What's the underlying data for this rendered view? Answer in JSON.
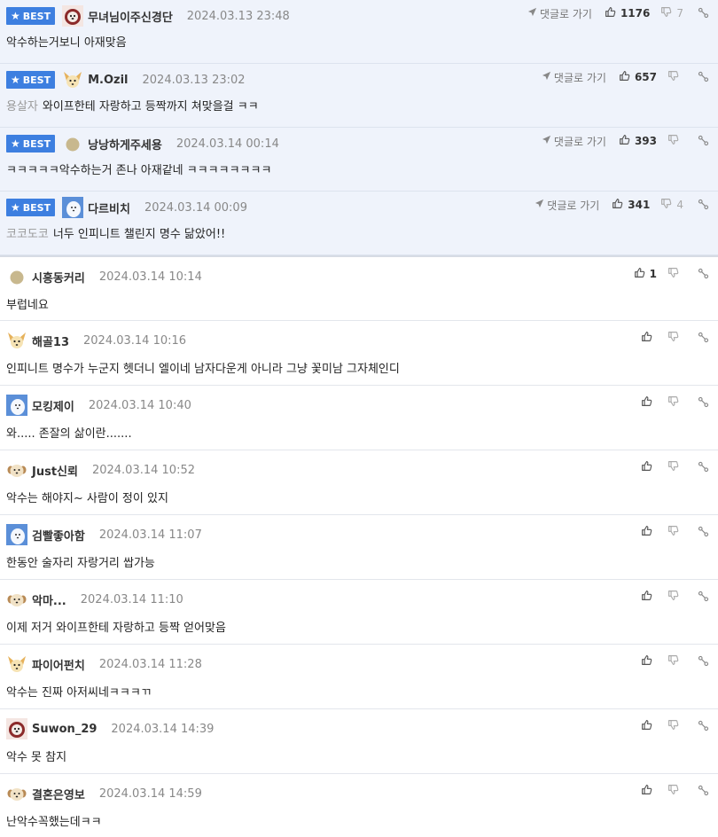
{
  "labels": {
    "best": "BEST",
    "goto_reply": "댓글로 가기"
  },
  "colors": {
    "best_bg": "#eff3fb",
    "badge": "#3d7fe0"
  },
  "best_comments": [
    {
      "avatar": "dog-red",
      "nick": "무녀님이주신경단",
      "date": "2024.03.13 23:48",
      "prefix": "",
      "text": "악수하는거보니 아재맞음",
      "likes": "1176",
      "dislikes": "7"
    },
    {
      "avatar": "chihuahua",
      "nick": "M.Ozil",
      "date": "2024.03.13 23:02",
      "prefix": "용살자",
      "text": "와이프한테 자랑하고 등짝까지 쳐맞을걸 ㅋㅋ",
      "likes": "657",
      "dislikes": ""
    },
    {
      "avatar": "circle-tan",
      "nick": "낭낭하게주세용",
      "date": "2024.03.14 00:14",
      "prefix": "",
      "text": "ㅋㅋㅋㅋㅋ악수하는거 존나 아재같네 ㅋㅋㅋㅋㅋㅋㅋㅋ",
      "likes": "393",
      "dislikes": ""
    },
    {
      "avatar": "blue-pup",
      "nick": "다르비치",
      "date": "2024.03.14 00:09",
      "prefix": "코코도코",
      "text": "너두 인피니트 챌린지 명수 닮았어!!",
      "likes": "341",
      "dislikes": "4"
    }
  ],
  "comments": [
    {
      "avatar": "circle-tan",
      "nick": "시흥동커리",
      "date": "2024.03.14 10:14",
      "text": "부럽네요",
      "likes": "1",
      "dislikes": ""
    },
    {
      "avatar": "chihuahua",
      "nick": "해골13",
      "date": "2024.03.14 10:16",
      "text": "인피니트 명수가 누군지 헷더니 엘이네 남자다운게 아니라 그냥 꽃미남 그자체인디",
      "likes": "",
      "dislikes": ""
    },
    {
      "avatar": "blue-pup",
      "nick": "모킹제이",
      "date": "2024.03.14 10:40",
      "text": "와..... 존잘의 삶이란.......",
      "likes": "",
      "dislikes": ""
    },
    {
      "avatar": "puppy-cream",
      "nick": "Just신뢰",
      "date": "2024.03.14 10:52",
      "text": "악수는 해야지~ 사람이 정이 있지",
      "likes": "",
      "dislikes": ""
    },
    {
      "avatar": "blue-pup",
      "nick": "검빨좋아함",
      "date": "2024.03.14 11:07",
      "text": "한동안 술자리 자랑거리 쌉가능",
      "likes": "",
      "dislikes": ""
    },
    {
      "avatar": "puppy-cream",
      "nick": "악마...",
      "date": "2024.03.14 11:10",
      "text": "이제 저거 와이프한테 자랑하고 등짝 얻어맞음",
      "likes": "",
      "dislikes": ""
    },
    {
      "avatar": "chihuahua",
      "nick": "파이어펀치",
      "date": "2024.03.14 11:28",
      "text": "악수는 진짜 아저씨네ㅋㅋㅋㄲ",
      "likes": "",
      "dislikes": ""
    },
    {
      "avatar": "dog-red",
      "nick": "Suwon_29",
      "date": "2024.03.14 14:39",
      "text": "악수 못 참지",
      "likes": "",
      "dislikes": ""
    },
    {
      "avatar": "puppy-cream",
      "nick": "결혼은영보",
      "date": "2024.03.14 14:59",
      "text": "난악수꼭했는데ㅋㅋ",
      "likes": "",
      "dislikes": ""
    }
  ]
}
